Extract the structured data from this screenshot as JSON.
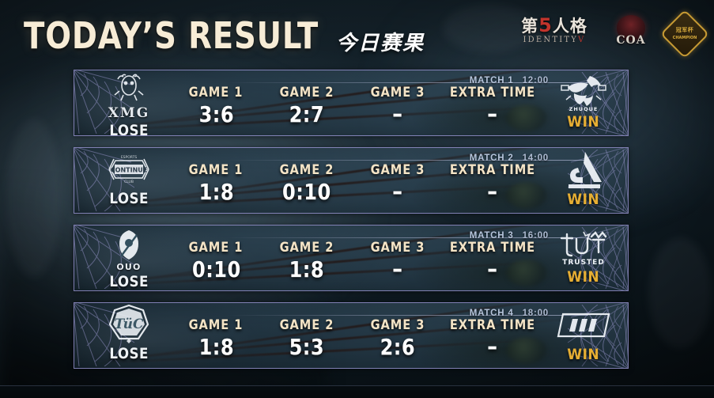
{
  "header": {
    "title_main": "TODAY’S  RESULT",
    "title_sub": "今日赛果",
    "logos": [
      {
        "name": "identity-v-logo",
        "cn_left": "第",
        "cn_five": "5",
        "cn_right": "人格",
        "en": "IDENTITY",
        "en_v": "V"
      },
      {
        "name": "coa-logo",
        "text": "COA"
      },
      {
        "name": "tournament-badge-logo",
        "line1": "冠军杯",
        "line2": "CHAMPION"
      }
    ]
  },
  "matches": [
    {
      "match_label": "MATCH 1",
      "time": "12:00",
      "team_left": {
        "tag": "XMG",
        "logo": "xmg-logo",
        "result": "LOSE"
      },
      "team_right": {
        "tag": "ZHUQUE",
        "logo": "zhuque-bird-logo",
        "result": "WIN"
      },
      "games": [
        {
          "name": "GAME 1",
          "score": "3:6"
        },
        {
          "name": "GAME 2",
          "score": "2:7"
        },
        {
          "name": "GAME 3",
          "score": "–"
        },
        {
          "name": "EXTRA TIME",
          "score": "–"
        }
      ]
    },
    {
      "match_label": "MATCH 2",
      "time": "14:00",
      "team_left": {
        "tag": "CONTINUE",
        "logo": "continue-logo",
        "result": "LOSE"
      },
      "team_right": {
        "tag": "",
        "logo": "triangle-a-logo",
        "result": "WIN"
      },
      "games": [
        {
          "name": "GAME 1",
          "score": "1:8"
        },
        {
          "name": "GAME 2",
          "score": "0:10"
        },
        {
          "name": "GAME 3",
          "score": "–"
        },
        {
          "name": "EXTRA TIME",
          "score": "–"
        }
      ]
    },
    {
      "match_label": "MATCH 3",
      "time": "16:00",
      "team_left": {
        "tag": "OUO",
        "logo": "ouo-logo",
        "result": "LOSE"
      },
      "team_right": {
        "tag": "TRUSTED",
        "logo": "trust-crown-logo",
        "result": "WIN"
      },
      "games": [
        {
          "name": "GAME 1",
          "score": "0:10"
        },
        {
          "name": "GAME 2",
          "score": "1:8"
        },
        {
          "name": "GAME 3",
          "score": "–"
        },
        {
          "name": "EXTRA TIME",
          "score": "–"
        }
      ]
    },
    {
      "match_label": "MATCH 4",
      "time": "18:00",
      "team_left": {
        "tag": "TUC",
        "logo": "tuc-pentagon-logo",
        "result": "LOSE"
      },
      "team_right": {
        "tag": "",
        "logo": "stripes-parallelogram-logo",
        "result": "WIN"
      },
      "games": [
        {
          "name": "GAME 1",
          "score": "1:8"
        },
        {
          "name": "GAME 2",
          "score": "5:3"
        },
        {
          "name": "GAME 3",
          "score": "2:6"
        },
        {
          "name": "EXTRA TIME",
          "score": "–"
        }
      ]
    }
  ],
  "colors": {
    "title_cream": "#f7ecd6",
    "game_label_cream": "#f4e4c6",
    "score_white": "#ffffff",
    "win_gold": "#e6ae33",
    "lose_white": "#eef2f5",
    "match_label_blue": "#b7c6dd",
    "panel_border_purple": "#9692ce",
    "background_dark": "#0d1920"
  }
}
